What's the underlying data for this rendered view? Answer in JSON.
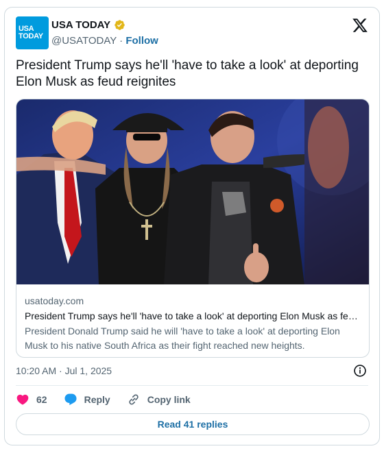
{
  "account": {
    "logo_line1": "USA",
    "logo_line2": "TODAY",
    "display_name": "USA TODAY",
    "handle": "@USATODAY",
    "separator": "·",
    "follow_label": "Follow"
  },
  "tweet": {
    "text": "President Trump says he'll 'have to take a look' at deporting Elon Musk as feud reignites",
    "timestamp": "10:20 AM · Jul 1, 2025"
  },
  "link_card": {
    "domain": "usatoday.com",
    "title": "President Trump says he'll 'have to take a look' at deporting Elon Musk as feud reignites",
    "description": "President Donald Trump said he will 'have to take a look' at deporting Elon Musk to his native South Africa as their fight reached new heights."
  },
  "actions": {
    "like_count": "62",
    "reply_label": "Reply",
    "copy_link_label": "Copy link",
    "read_replies_label": "Read 41 replies"
  },
  "colors": {
    "brand_blue": "#009bde",
    "link_blue": "#1d6fa5",
    "like_pink": "#f91880",
    "reply_blue": "#1d9bf0",
    "verified_gold": "#e2b719"
  },
  "icons": [
    "verified-badge-icon",
    "x-logo-icon",
    "info-icon",
    "heart-icon",
    "reply-bubble-icon",
    "link-icon"
  ]
}
